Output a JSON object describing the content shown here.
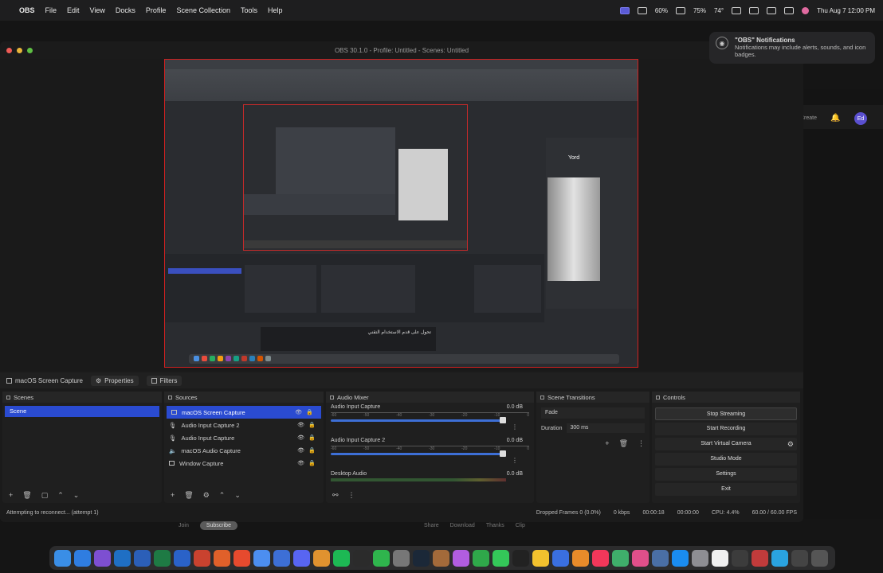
{
  "menubar": {
    "app_name": "OBS",
    "menus": [
      "File",
      "Edit",
      "View",
      "Docks",
      "Profile",
      "Scene Collection",
      "Tools",
      "Help"
    ],
    "status": {
      "cpu": "60%",
      "battery_pct": "75%",
      "temp": "74°"
    },
    "clock": "Thu Aug 7  12:00 PM"
  },
  "window": {
    "title": "OBS 30.1.0 - Profile: Untitled - Scenes: Untitled"
  },
  "preview": {
    "nested_label": "Yord",
    "caption_text": "تحول على قدم الاستخدام التقني"
  },
  "notification": {
    "title": "\"OBS\" Notifications",
    "body": "Notifications may include alerts, sounds, and icon badges."
  },
  "bg_app": {
    "create_label": "Create",
    "avatar_initials": "Ed"
  },
  "source_toolbar": {
    "source_name": "macOS Screen Capture",
    "properties_label": "Properties",
    "filters_label": "Filters"
  },
  "docks": {
    "scenes": {
      "title": "Scenes",
      "items": [
        "Scene"
      ]
    },
    "sources": {
      "title": "Sources",
      "items": [
        {
          "name": "macOS Screen Capture",
          "selected": true
        },
        {
          "name": "Audio Input Capture 2",
          "selected": false
        },
        {
          "name": "Audio Input Capture",
          "selected": false
        },
        {
          "name": "macOS Audio Capture",
          "selected": false
        },
        {
          "name": "Window Capture",
          "selected": false
        }
      ]
    },
    "mixer": {
      "title": "Audio Mixer",
      "channels": [
        {
          "name": "Audio Input Capture",
          "db": "0.0 dB"
        },
        {
          "name": "Audio Input Capture 2",
          "db": "0.0 dB"
        },
        {
          "name": "Desktop Audio",
          "db": "0.0 dB"
        }
      ],
      "scale": [
        "-60",
        "-55",
        "-50",
        "-45",
        "-40",
        "-35",
        "-30",
        "-25",
        "-20",
        "-15",
        "-10",
        "-5",
        "0"
      ]
    },
    "transitions": {
      "title": "Scene Transitions",
      "transition": "Fade",
      "duration_label": "Duration",
      "duration_value": "300 ms"
    },
    "controls": {
      "title": "Controls",
      "buttons": [
        "Stop Streaming",
        "Start Recording",
        "Start Virtual Camera",
        "Studio Mode",
        "Settings",
        "Exit"
      ]
    }
  },
  "statusbar": {
    "message": "Attempting to reconnect... (attempt 1)",
    "dropped_frames": "Dropped Frames 0 (0.0%)",
    "bitrate": "0 kbps",
    "stream_time": "00:00:18",
    "record_time": "00:00:00",
    "cpu": "CPU: 4.4%",
    "fps": "60.00 / 60.00 FPS"
  },
  "under_page": {
    "join_label": "Join",
    "subscribe_label": "Subscribe",
    "share_label": "Share",
    "download_label": "Download",
    "thanks_label": "Thanks",
    "clip_label": "Clip"
  },
  "colors": {
    "accent_blue": "#2a4bd1",
    "preview_border": "#d02020",
    "record_red": "#ee5b56"
  }
}
